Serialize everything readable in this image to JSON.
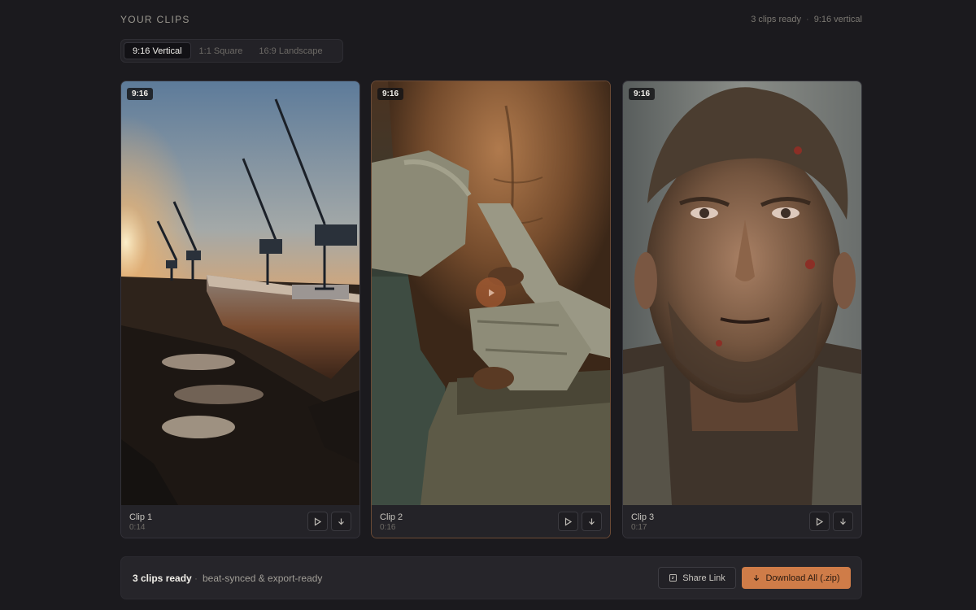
{
  "header": {
    "title": "YOUR CLIPS",
    "status_count": "3 clips ready",
    "status_format": "9:16 vertical"
  },
  "tabs": [
    {
      "label": "9:16 Vertical",
      "active": true
    },
    {
      "label": "1:1 Square",
      "active": false
    },
    {
      "label": "16:9 Landscape",
      "active": false
    }
  ],
  "clips": [
    {
      "badge": "9:16",
      "name": "Clip 1",
      "duration": "0:14",
      "scene": "shipyard-cranes-sunset"
    },
    {
      "badge": "9:16",
      "name": "Clip 2",
      "duration": "0:16",
      "scene": "boxer-wrapping-hands",
      "selected": true
    },
    {
      "badge": "9:16",
      "name": "Clip 3",
      "duration": "0:17",
      "scene": "bruised-fighter-portrait"
    }
  ],
  "bottom_bar": {
    "count": "3 clips ready",
    "separator": "·",
    "description": "beat-synced & export-ready",
    "share_label": "Share Link",
    "download_label": "Download All (.zip)"
  },
  "colors": {
    "background": "#1b1a1e",
    "card": "#242328",
    "accent": "#cf7c48",
    "selected_border": "#6b4a35"
  },
  "icons": {
    "play": "play-icon",
    "download": "download-icon",
    "share": "share-icon"
  }
}
